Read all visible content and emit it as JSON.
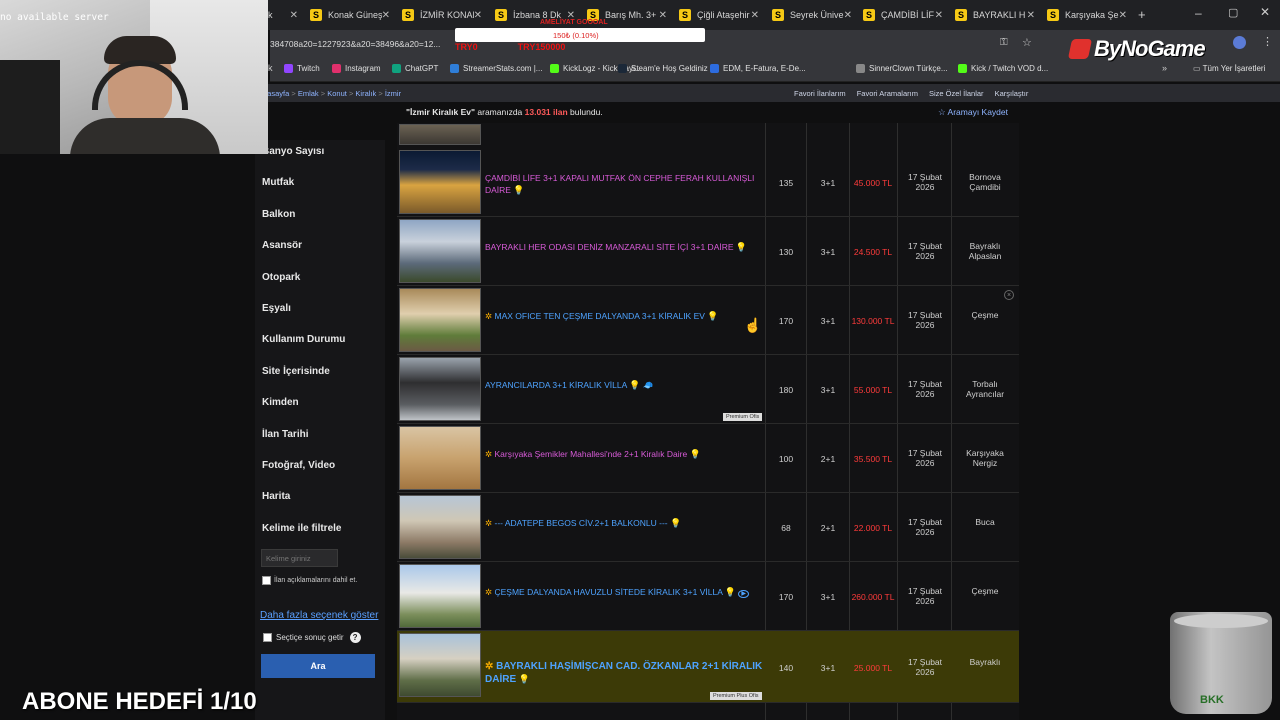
{
  "browser": {
    "tabs": [
      {
        "favicon": "S",
        "title": "Konak Güneş"
      },
      {
        "favicon": "S",
        "title": "İZMİR KONAK"
      },
      {
        "favicon": "S",
        "title": "İzbana 8 Dk"
      },
      {
        "favicon": "S",
        "title": "Barış Mh. 3+"
      },
      {
        "favicon": "S",
        "title": "Çiğli Ataşehir"
      },
      {
        "favicon": "S",
        "title": "Seyrek Ünive"
      },
      {
        "favicon": "S",
        "title": "ÇAMDİBİ LİF"
      },
      {
        "favicon": "S",
        "title": "BAYRAKLI H"
      },
      {
        "favicon": "S",
        "title": "Karşıyaka Şe"
      }
    ],
    "url": "384708a20=1227923&a20=38496&a20=12...",
    "bookmarks": [
      "Twitch",
      "Instagram",
      "ChatGPT",
      "StreamerStats.com |...",
      "KickLogz - Kick Yayı...",
      "Steam'e Hoş Geldiniz",
      "EDM, E-Fatura, E-De...",
      "SinnerClown Türkçe...",
      "Kick / Twitch VOD d..."
    ],
    "bookmarks_all": "Tüm Yer İşaretleri",
    "bookmark_colors": [
      "#9146ff",
      "#e1306c",
      "#10a37f",
      "#2f7ed8",
      "#53fc18",
      "#1b2838",
      "#2d6cdf",
      "#888888",
      "#53fc18"
    ]
  },
  "overlay": {
    "webcam_text": "no available server",
    "donation_line1": "AMELİYAT GOOOAL",
    "donation_line2": "150₺ (0.10%)",
    "donation_line3": "TRY0                TRY150000",
    "logo": "ByNoGame",
    "goal": "ABONE HEDEFİ 1/10",
    "cup_label": "BKK"
  },
  "site": {
    "breadcrumb": [
      "Anasayfa",
      "Emlak",
      "Konut",
      "Kiralık",
      "İzmir"
    ],
    "nav_links": [
      "Favori İlanlarım",
      "Favori Aramalarım",
      "Size Özel İlanlar",
      "Karşılaştır"
    ],
    "search_query": "\"İzmir Kiralık Ev\"",
    "search_mid": "aramanızda",
    "result_count": "13.031 ilan",
    "result_suffix": "bulundu.",
    "save_search": "Aramayı Kaydet"
  },
  "filters": {
    "items": [
      "Banyo Sayısı",
      "Mutfak",
      "Balkon",
      "Asansör",
      "Otopark",
      "Eşyalı",
      "Kullanım Durumu",
      "Site İçerisinde",
      "Kimden",
      "İlan Tarihi",
      "Fotoğraf, Video",
      "Harita",
      "Kelime ile filtrele"
    ],
    "keyword_placeholder": "Kelime giriniz",
    "include_desc": "İlan açıklamalarını dahil et.",
    "more_options": "Daha fazla seçenek göster",
    "selective": "Seçtiçe sonuç getir",
    "search_button": "Ara"
  },
  "listings": [
    {
      "title": "ÇAMDİBİ LİFE 3+1 KAPALI MUTFAK ÖN CEPHE FERAH KULLANIŞLI DAİRE",
      "color": "#d85bd8",
      "m2": "135",
      "rooms": "3+1",
      "price": "45.000 TL",
      "date": "17 Şubat 2026",
      "location": "Bornova Çamdibi",
      "star": false,
      "premium": ""
    },
    {
      "title": "BAYRAKLI HER ODASI DENİZ MANZARALI SİTE İÇİ 3+1 DAİRE",
      "color": "#d85bd8",
      "m2": "130",
      "rooms": "3+1",
      "price": "24.500 TL",
      "date": "17 Şubat 2026",
      "location": "Bayraklı Alpaslan",
      "star": false,
      "premium": ""
    },
    {
      "title": "MAX OFICE TEN ÇEŞME DALYANDA 3+1 KİRALIK EV",
      "color": "#4ea3ff",
      "m2": "170",
      "rooms": "3+1",
      "price": "130.000 TL",
      "date": "17 Şubat 2026",
      "location": "Çeşme",
      "star": true,
      "premium": ""
    },
    {
      "title": "AYRANCILARDA 3+1 KİRALIK VİLLA",
      "color": "#4ea3ff",
      "m2": "180",
      "rooms": "3+1",
      "price": "55.000 TL",
      "date": "17 Şubat 2026",
      "location": "Torbalı Ayrancılar",
      "star": false,
      "premium": "Premium Ofis"
    },
    {
      "title": "Karşıyaka Şemikler Mahallesi'nde 2+1 Kiralık Daire",
      "color": "#d85bd8",
      "m2": "100",
      "rooms": "2+1",
      "price": "35.500 TL",
      "date": "17 Şubat 2026",
      "location": "Karşıyaka Nergiz",
      "star": true,
      "premium": ""
    },
    {
      "title": "--- ADATEPE BEGOS CİV.2+1 BALKONLU ---",
      "color": "#4ea3ff",
      "m2": "68",
      "rooms": "2+1",
      "price": "22.000 TL",
      "date": "17 Şubat 2026",
      "location": "Buca",
      "star": true,
      "premium": ""
    },
    {
      "title": "ÇEŞME DALYANDA HAVUZLU SİTEDE KİRALIK 3+1 VİLLA",
      "color": "#4ea3ff",
      "m2": "170",
      "rooms": "3+1",
      "price": "260.000 TL",
      "date": "17 Şubat 2026",
      "location": "Çeşme",
      "star": true,
      "premium": ""
    },
    {
      "title": "BAYRAKLI HAŞİMİŞCAN CAD. ÖZKANLAR 2+1 KİRALIK DAİRE",
      "color": "#4ea3ff",
      "m2": "140",
      "rooms": "3+1",
      "price": "25.000 TL",
      "date": "17 Şubat 2026",
      "location": "Bayraklı",
      "star": true,
      "premium": "Premium Plus Ofis"
    }
  ]
}
